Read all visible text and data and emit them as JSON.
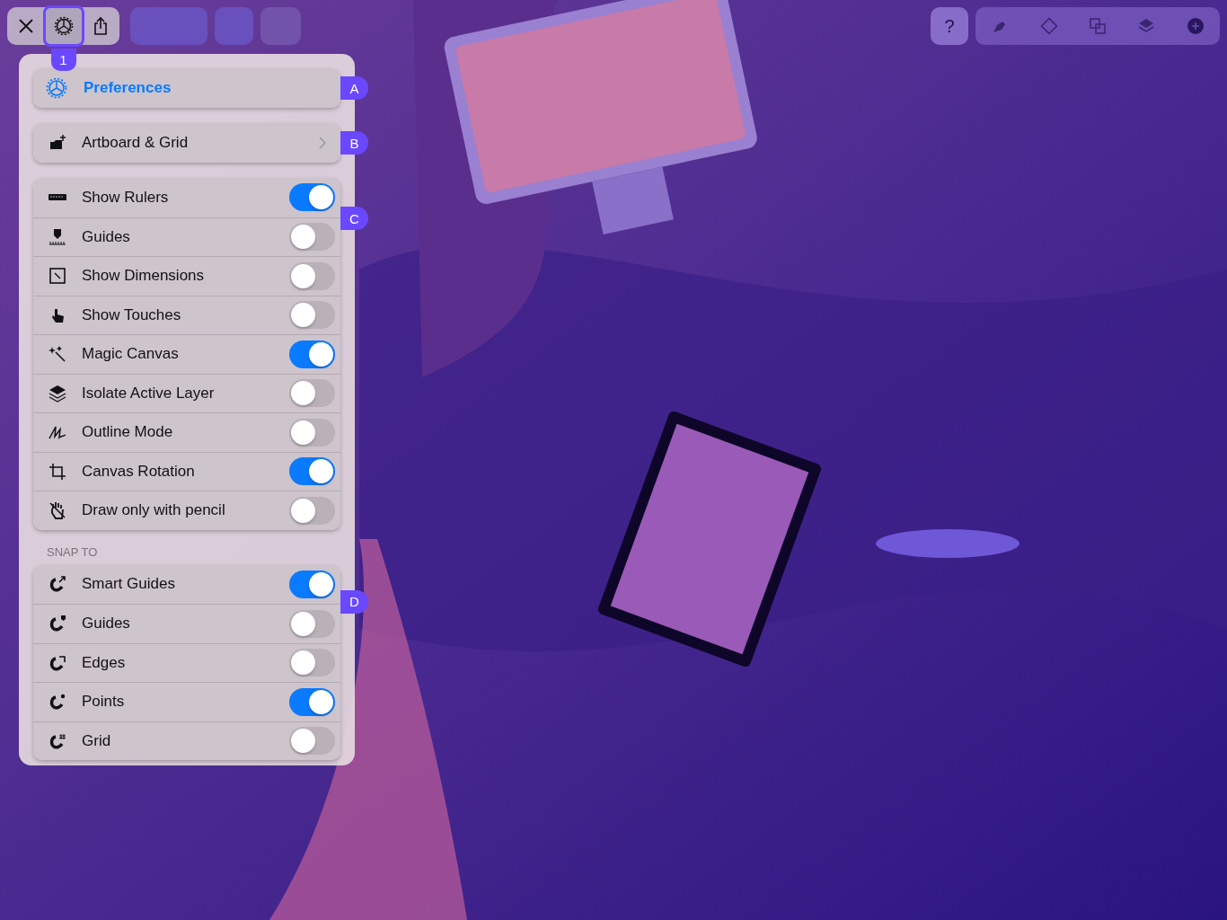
{
  "toolbar": {
    "settings_callout": "1"
  },
  "help_button": "?",
  "menu": {
    "header": {
      "label": "Preferences",
      "callout": "A"
    },
    "artboard": {
      "label": "Artboard & Grid",
      "callout": "B"
    },
    "toggles": {
      "callout": "C",
      "items": [
        {
          "label": "Show Rulers",
          "on": true
        },
        {
          "label": "Guides",
          "on": false
        },
        {
          "label": "Show Dimensions",
          "on": false
        },
        {
          "label": "Show Touches",
          "on": false
        },
        {
          "label": "Magic Canvas",
          "on": true
        },
        {
          "label": "Isolate Active Layer",
          "on": false
        },
        {
          "label": "Outline Mode",
          "on": false
        },
        {
          "label": "Canvas Rotation",
          "on": true
        },
        {
          "label": "Draw only with pencil",
          "on": false
        }
      ]
    },
    "snap": {
      "title": "SNAP TO",
      "callout": "D",
      "items": [
        {
          "label": "Smart Guides",
          "on": true
        },
        {
          "label": "Guides",
          "on": false
        },
        {
          "label": "Edges",
          "on": false
        },
        {
          "label": "Points",
          "on": true
        },
        {
          "label": "Grid",
          "on": false
        }
      ]
    }
  }
}
